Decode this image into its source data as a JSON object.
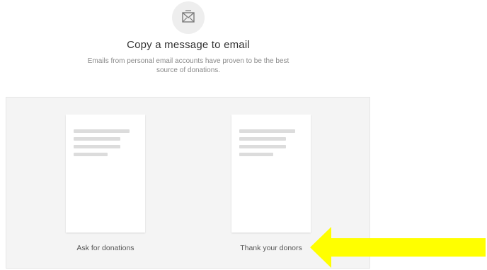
{
  "header": {
    "icon": "envelope-icon",
    "title": "Copy a message to email",
    "subtitle": "Emails from personal email accounts have proven to be the best source of donations."
  },
  "templates": [
    {
      "label": "Ask for donations"
    },
    {
      "label": "Thank your donors"
    }
  ],
  "annotation": {
    "icon": "arrow-left-icon",
    "color": "#ffff00",
    "points_to": "Thank your donors"
  },
  "colors": {
    "panel_background": "#f4f4f4",
    "icon_background": "#eeeeee"
  }
}
